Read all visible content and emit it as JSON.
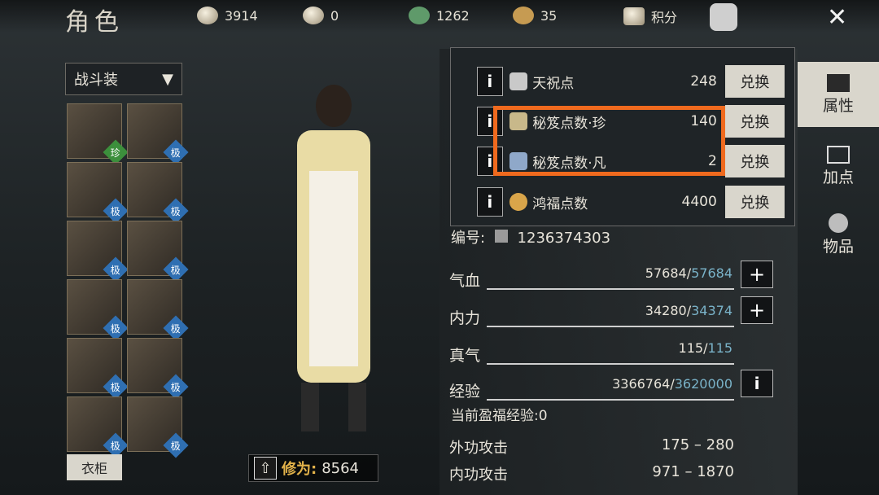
{
  "header": {
    "title": "角色",
    "currencies": [
      {
        "icon": "coin-icon",
        "value": "3914"
      },
      {
        "icon": "silver-ingot-icon",
        "value": "0"
      },
      {
        "icon": "jade-ticket-icon",
        "value": "1262"
      },
      {
        "icon": "gold-ingot-icon",
        "value": "35"
      }
    ],
    "points_label": "积分",
    "close_label": "✕"
  },
  "left": {
    "outfit_label": "战斗装",
    "slots": [
      {
        "badge": "珍",
        "color": "#3c8f3c"
      },
      {
        "badge": "极",
        "color": "#2f6fb2"
      },
      {
        "badge": "极",
        "color": "#2f6fb2"
      },
      {
        "badge": "极",
        "color": "#2f6fb2"
      },
      {
        "badge": "极",
        "color": "#2f6fb2"
      },
      {
        "badge": "极",
        "color": "#2f6fb2"
      },
      {
        "badge": "极",
        "color": "#2f6fb2"
      },
      {
        "badge": "极",
        "color": "#2f6fb2"
      },
      {
        "badge": "极",
        "color": "#2f6fb2"
      },
      {
        "badge": "极",
        "color": "#2f6fb2"
      },
      {
        "badge": "极",
        "color": "#2f6fb2"
      },
      {
        "badge": "极",
        "color": "#2f6fb2"
      }
    ],
    "wardrobe_label": "衣柜"
  },
  "character": {
    "power_label": "修为:",
    "power_value": "8564"
  },
  "popup": {
    "rows": [
      {
        "name": "天祝点",
        "value": "248",
        "button": "兑换"
      },
      {
        "name": "秘笈点数·珍",
        "value": "140",
        "button": "兑换"
      },
      {
        "name": "秘笈点数·凡",
        "value": "2",
        "button": "兑换"
      },
      {
        "name": "鸿福点数",
        "value": "4400",
        "button": "兑换"
      }
    ]
  },
  "stats": {
    "id_label": "编号:",
    "id_value": "1236374303",
    "bars": [
      {
        "name": "气血",
        "current": "57684",
        "max": "57684"
      },
      {
        "name": "内力",
        "current": "34280",
        "max": "34374"
      },
      {
        "name": "真气",
        "current": "115",
        "max": "115"
      },
      {
        "name": "经验",
        "current": "3366764",
        "max": "3620000"
      }
    ],
    "exp_bonus": "当前盈福经验:0",
    "attacks": [
      {
        "name": "外功攻击",
        "value": "175 – 280"
      },
      {
        "name": "内功攻击",
        "value": "971 – 1870"
      }
    ]
  },
  "side_tabs": [
    {
      "label": "属性",
      "icon": "scholar-hat-icon"
    },
    {
      "label": "加点",
      "icon": "sliders-icon"
    },
    {
      "label": "物品",
      "icon": "pouch-icon"
    }
  ],
  "colors": {
    "highlight": "#f06a1e",
    "badge_blue": "#2f6fb2",
    "badge_green": "#3c8f3c",
    "power_gold": "#e2b24a"
  }
}
